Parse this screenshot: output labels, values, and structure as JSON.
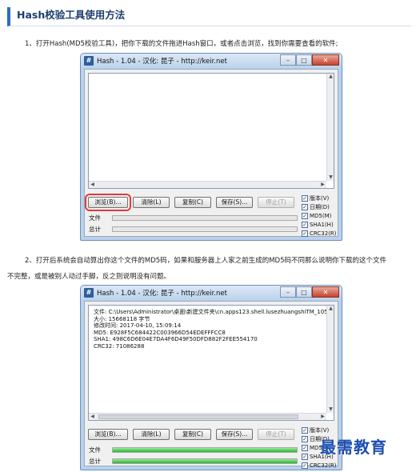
{
  "page": {
    "heading": "Hash校验工具使用方法",
    "step1": "1、打开Hash(MD5校验工具)，把你下载的文件拖进Hash窗口，或者点击浏览，找到你需要查看的软件;",
    "step2_line1": "2、打开后系统会自动算出你这个文件的MD5码，如果和服务器上人家之前生成的MD5码不同那么说明你下载的这个文件",
    "step2_line2": "不完整，或是被别人动过手脚，反之则说明没有问题。",
    "watermark": "最需教育"
  },
  "window1": {
    "title": "Hash - 1.04 - 汉化: 昆子 - http://keir.net",
    "buttons": {
      "browse": "浏览(B)...",
      "clear": "清除(L)",
      "copy": "复制(C)",
      "save": "保存(S)...",
      "stop": "停止(T)"
    },
    "file_label": "文件",
    "total_label": "总计",
    "file_progress": 0,
    "total_progress": 0,
    "options": {
      "version": "版本(V)",
      "date": "日期(D)",
      "md5": "MD5(M)",
      "sha1": "SHA1(H)",
      "crc32": "CRC32(R)"
    },
    "checked": [
      true,
      true,
      true,
      true,
      true
    ]
  },
  "window2": {
    "title": "Hash - 1.04 - 汉化: 昆子 - http://keir.net",
    "result": {
      "file": "文件: C:\\Users\\Administrator\\桌面\\新建文件夹\\cn.apps123.shell.lusezhuangshiTM_105",
      "size": "大小: 15668118 字节",
      "modified": "修改时间: 2017-04-10, 15:09:14",
      "md5": "MD5: E928F5C684422C003966D54EDEFFFCC8",
      "sha1": "SHA1: 498C6D6E04E7DA4F6D49F50DFD882F2FEE554170",
      "crc32": "CRC32: 71086288"
    },
    "buttons": {
      "browse": "浏览(B)...",
      "clear": "清除(L)",
      "copy": "复制(C)",
      "save": "保存(S)...",
      "stop": "停止(T)"
    },
    "file_label": "文件",
    "total_label": "总计",
    "file_progress": 100,
    "total_progress": 100,
    "options": {
      "version": "版本(V)",
      "date": "日期(D)",
      "md5": "MD5(M)",
      "sha1": "SHA1(H)",
      "crc32": "CRC32(R)"
    },
    "checked": [
      true,
      true,
      true,
      true,
      true
    ]
  },
  "colors": {
    "accent": "#2a6ebb",
    "highlight": "#e23a3a",
    "progress": "#27b532",
    "watermark": "#1d4eb0"
  }
}
